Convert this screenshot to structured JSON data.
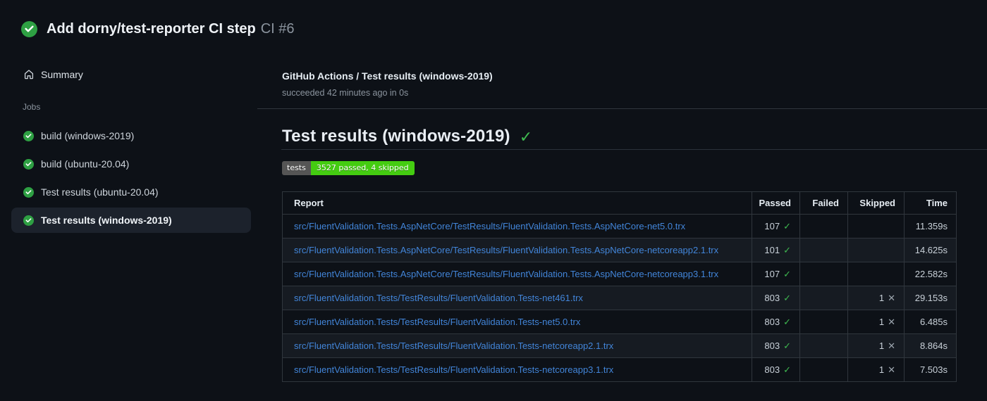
{
  "header": {
    "title": "Add dorny/test-reporter CI step",
    "run_number": "CI #6",
    "status_icon": "check-circle"
  },
  "sidebar": {
    "summary_label": "Summary",
    "jobs_label": "Jobs",
    "jobs": [
      {
        "label": "build (windows-2019)",
        "selected": false
      },
      {
        "label": "build (ubuntu-20.04)",
        "selected": false
      },
      {
        "label": "Test results (ubuntu-20.04)",
        "selected": false
      },
      {
        "label": "Test results (windows-2019)",
        "selected": true
      }
    ]
  },
  "main": {
    "check_title": "GitHub Actions / Test results (windows-2019)",
    "check_status": "succeeded 42 minutes ago in 0s",
    "heading": "Test results (windows-2019)",
    "heading_check_glyph": "✓",
    "badge": {
      "label": "tests",
      "value": "3527 passed, 4 skipped"
    },
    "table": {
      "columns": [
        "Report",
        "Passed",
        "Failed",
        "Skipped",
        "Time"
      ],
      "rows": [
        {
          "report": "src/FluentValidation.Tests.AspNetCore/TestResults/FluentValidation.Tests.AspNetCore-net5.0.trx",
          "passed": "107",
          "failed": "",
          "skipped": "",
          "time": "11.359s"
        },
        {
          "report": "src/FluentValidation.Tests.AspNetCore/TestResults/FluentValidation.Tests.AspNetCore-netcoreapp2.1.trx",
          "passed": "101",
          "failed": "",
          "skipped": "",
          "time": "14.625s"
        },
        {
          "report": "src/FluentValidation.Tests.AspNetCore/TestResults/FluentValidation.Tests.AspNetCore-netcoreapp3.1.trx",
          "passed": "107",
          "failed": "",
          "skipped": "",
          "time": "22.582s"
        },
        {
          "report": "src/FluentValidation.Tests/TestResults/FluentValidation.Tests-net461.trx",
          "passed": "803",
          "failed": "",
          "skipped": "1",
          "time": "29.153s"
        },
        {
          "report": "src/FluentValidation.Tests/TestResults/FluentValidation.Tests-net5.0.trx",
          "passed": "803",
          "failed": "",
          "skipped": "1",
          "time": "6.485s"
        },
        {
          "report": "src/FluentValidation.Tests/TestResults/FluentValidation.Tests-netcoreapp2.1.trx",
          "passed": "803",
          "failed": "",
          "skipped": "1",
          "time": "8.864s"
        },
        {
          "report": "src/FluentValidation.Tests/TestResults/FluentValidation.Tests-netcoreapp3.1.trx",
          "passed": "803",
          "failed": "",
          "skipped": "1",
          "time": "7.503s"
        }
      ],
      "passed_glyph": "✓",
      "skipped_glyph": "✕"
    }
  },
  "colors": {
    "bg": "#0d1117",
    "row_alt": "#161b22",
    "border": "#30363d",
    "border2": "#2b323b",
    "sel_bg": "#1c222c",
    "link": "#4285d9",
    "green_icon": "#2ea043",
    "green_check": "#3fb950",
    "badge_green": "#44cc11",
    "badge_gray": "#555555"
  }
}
